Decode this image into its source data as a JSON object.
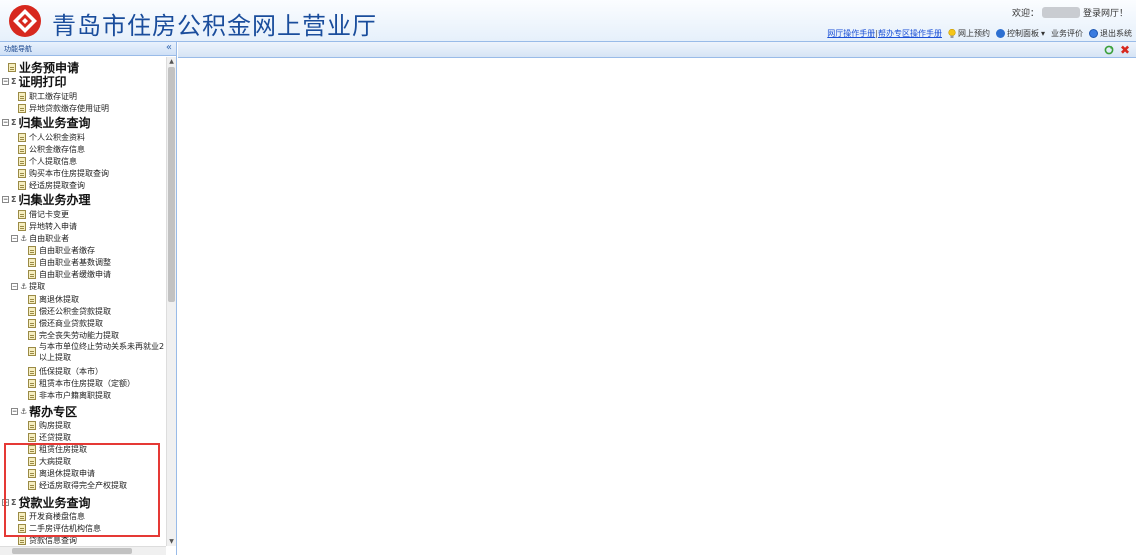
{
  "header": {
    "title": "青岛市住房公积金网上营业厅",
    "welcome_prefix": "欢迎：",
    "welcome_suffix": "登录网厅！",
    "links": {
      "manual": "网厅操作手册",
      "separator": "|",
      "help_manual": "帮办专区操作手册",
      "appointment": "网上预约",
      "control_panel": "控制面板",
      "rating": "业务评价",
      "logout": "退出系统"
    },
    "colors": {
      "title": "#1a4d9c",
      "link": "#1a4fd6",
      "logo": "#d7281e"
    }
  },
  "nav": {
    "title": "功能导航",
    "collapse_icon": "«",
    "items": [
      {
        "label": "业务预申请",
        "kind": "head"
      },
      {
        "label": "证明打印",
        "kind": "head"
      },
      {
        "label": "职工缴存证明",
        "kind": "leaf"
      },
      {
        "label": "异地贷款缴存使用证明",
        "kind": "leaf"
      },
      {
        "label": "归集业务查询",
        "kind": "head"
      },
      {
        "label": "个人公积金资料",
        "kind": "leaf"
      },
      {
        "label": "公积金缴存信息",
        "kind": "leaf"
      },
      {
        "label": "个人提取信息",
        "kind": "leaf"
      },
      {
        "label": "购买本市住房提取查询",
        "kind": "leaf"
      },
      {
        "label": "经适房提取查询",
        "kind": "leaf"
      },
      {
        "label": "归集业务办理",
        "kind": "head"
      },
      {
        "label": "借记卡变更",
        "kind": "leaf"
      },
      {
        "label": "异地转入申请",
        "kind": "leaf"
      },
      {
        "label": "自由职业者",
        "kind": "group"
      },
      {
        "label": "自由职业者缴存",
        "kind": "leaf"
      },
      {
        "label": "自由职业者基数调整",
        "kind": "leaf"
      },
      {
        "label": "自由职业者缓缴申请",
        "kind": "leaf"
      },
      {
        "label": "提取",
        "kind": "group"
      },
      {
        "label": "离退休提取",
        "kind": "leaf"
      },
      {
        "label": "偿还公积金贷款提取",
        "kind": "leaf"
      },
      {
        "label": "偿还商业贷款提取",
        "kind": "leaf"
      },
      {
        "label": "完全丧失劳动能力提取",
        "kind": "leaf"
      },
      {
        "label": "与本市单位终止劳动关系未再就业2以上提取",
        "kind": "leaf"
      },
      {
        "label": "低保提取（本市）",
        "kind": "leaf"
      },
      {
        "label": "租赁本市住房提取（定额）",
        "kind": "leaf"
      },
      {
        "label": "非本市户籍离职提取",
        "kind": "leaf"
      },
      {
        "label": "帮办专区",
        "kind": "head"
      },
      {
        "label": "购房提取",
        "kind": "leaf"
      },
      {
        "label": "还贷提取",
        "kind": "leaf"
      },
      {
        "label": "租赁住房提取",
        "kind": "leaf"
      },
      {
        "label": "大病提取",
        "kind": "leaf"
      },
      {
        "label": "离退休提取申请",
        "kind": "leaf"
      },
      {
        "label": "经适房取得完全产权提取",
        "kind": "leaf"
      },
      {
        "label": "贷款业务查询",
        "kind": "head"
      },
      {
        "label": "开发商楼盘信息",
        "kind": "leaf"
      },
      {
        "label": "二手房评估机构信息",
        "kind": "leaf"
      },
      {
        "label": "贷款信息查询",
        "kind": "leaf"
      }
    ]
  }
}
